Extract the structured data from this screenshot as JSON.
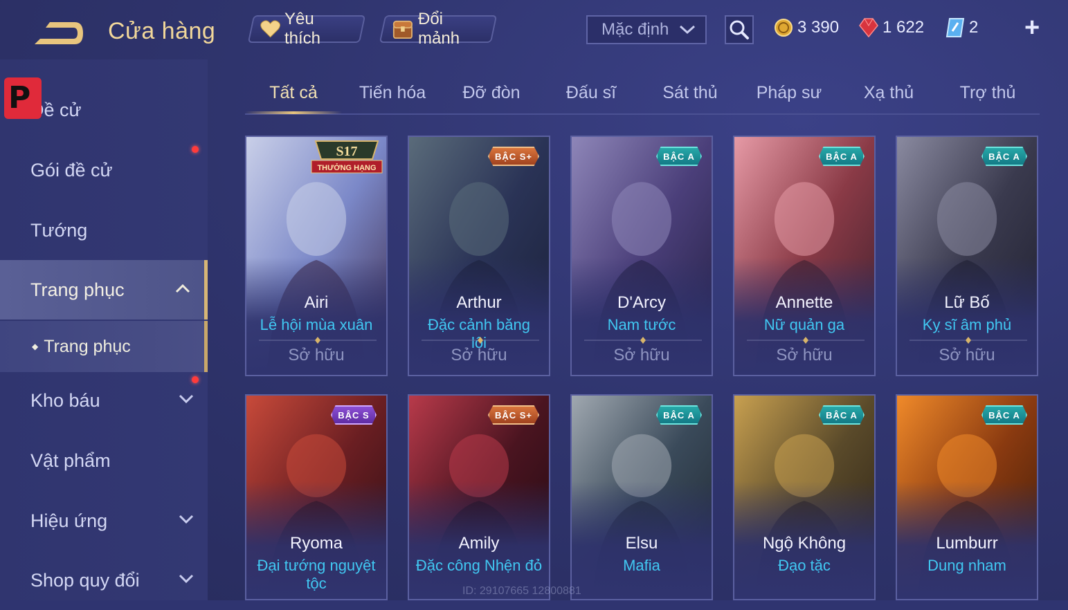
{
  "header": {
    "title": "Cửa hàng",
    "favorite_label": "Yêu thích",
    "fragment_label": "Đổi mảnh",
    "sort_value": "Mặc định",
    "gold": "3 390",
    "ruby": "1 622",
    "voucher": "2",
    "add_symbol": "+"
  },
  "sidebar": {
    "logo_letter": "P",
    "items": [
      {
        "label": "Đề cử"
      },
      {
        "label": "Gói đề cử"
      },
      {
        "label": "Tướng"
      },
      {
        "label": "Trang phục"
      },
      {
        "label": "Trang phục"
      },
      {
        "label": "Kho báu"
      },
      {
        "label": "Vật phẩm"
      },
      {
        "label": "Hiệu ứng"
      },
      {
        "label": "Shop quy đổi"
      }
    ],
    "sub_bullet": "◆"
  },
  "tabs": [
    "Tất cả",
    "Tiến hóa",
    "Đỡ đòn",
    "Đấu sĩ",
    "Sát thủ",
    "Pháp sư",
    "Xạ thủ",
    "Trợ thủ"
  ],
  "cards": [
    {
      "hero": "Airi",
      "skin": "Lễ hội mùa xuân",
      "status": "Sở hữu",
      "badge": "S17",
      "badge_sub": "THƯỞNG HẠNG",
      "colors": [
        "#7b88c8",
        "#c9cfe8",
        "#3d2a4a"
      ]
    },
    {
      "hero": "Arthur",
      "skin": "Đặc cảnh băng lôi",
      "status": "Sở hữu",
      "badge": "BẬC S+",
      "colors": [
        "#2a3356",
        "#5a6b7a",
        "#1a2038"
      ]
    },
    {
      "hero": "D'Arcy",
      "skin": "Nam tước",
      "status": "Sở hữu",
      "badge": "BẬC A",
      "colors": [
        "#4b3f7a",
        "#8e86b8",
        "#231f42"
      ]
    },
    {
      "hero": "Annette",
      "skin": "Nữ quản ga",
      "status": "Sở hữu",
      "badge": "BẬC A",
      "colors": [
        "#8a3a46",
        "#e69aa6",
        "#3a1e2c"
      ]
    },
    {
      "hero": "Lữ Bố",
      "skin": "Kỵ sĩ âm phủ",
      "status": "Sở hữu",
      "badge": "BẬC A",
      "colors": [
        "#3a3a4e",
        "#8a8aa0",
        "#1e1e2e"
      ]
    },
    {
      "hero": "Ryoma",
      "skin": "Đại tướng nguyệt tộc",
      "status": "",
      "badge": "BẬC S",
      "colors": [
        "#6a1e22",
        "#c84a3a",
        "#2a0e14"
      ]
    },
    {
      "hero": "Amily",
      "skin": "Đặc công Nhện đỏ",
      "status": "",
      "badge": "BẬC S+",
      "colors": [
        "#4a1420",
        "#b83a4a",
        "#200a12"
      ]
    },
    {
      "hero": "Elsu",
      "skin": "Mafia",
      "status": "",
      "badge": "BẬC A",
      "colors": [
        "#3a4a5a",
        "#a0a8b0",
        "#1e2630"
      ]
    },
    {
      "hero": "Ngộ Không",
      "skin": "Đạo tặc",
      "status": "",
      "badge": "BẬC A",
      "colors": [
        "#5a4a2a",
        "#c8a050",
        "#2a2014"
      ]
    },
    {
      "hero": "Lumburr",
      "skin": "Dung nham",
      "status": "",
      "badge": "BẬC A",
      "colors": [
        "#8a3a10",
        "#f08a2a",
        "#3a1a08"
      ]
    }
  ],
  "watermark": "ID: 29107665 12800881",
  "colors": {
    "accent_gold": "#e8c57e",
    "skin_name": "#41c8f2",
    "background": "#2f3470"
  }
}
